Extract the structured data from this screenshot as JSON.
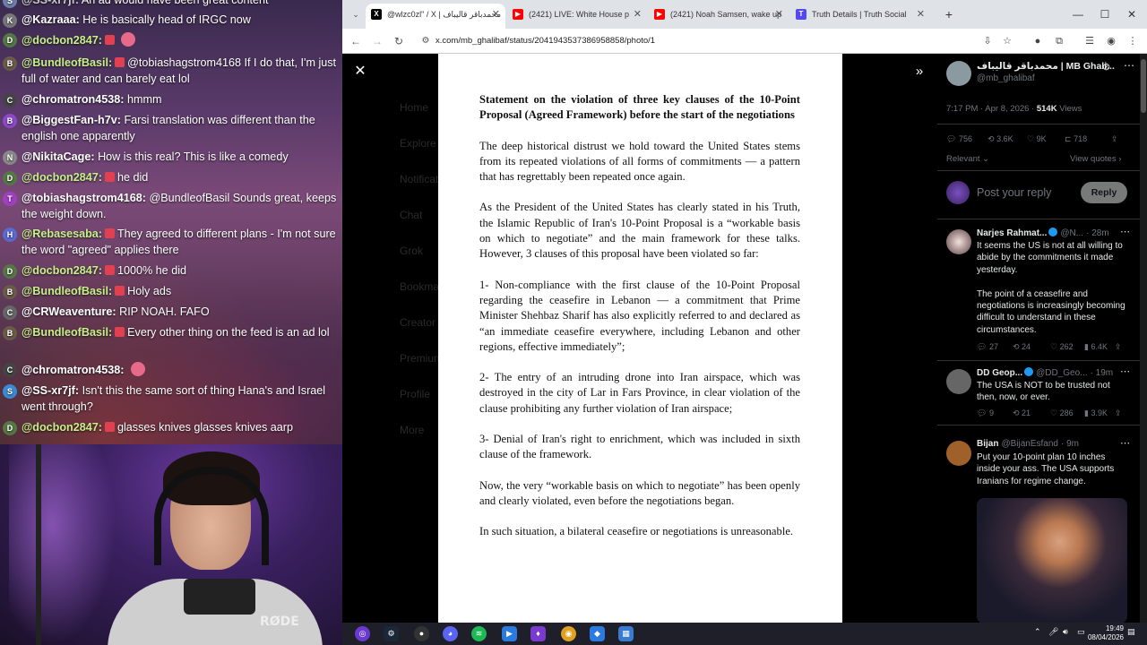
{
  "chat": {
    "messages": [
      {
        "user": "@SS-xr7jf:",
        "text": "An ad would have been great content",
        "color": "#c9c9c9",
        "avatar": "S",
        "avatar_color": "#6a7ea8"
      },
      {
        "user": "@Kazraaa:",
        "text": "He is basically head of IRGC now",
        "color": "#ffffff",
        "avatar": "K",
        "avatar_color": "#777777"
      },
      {
        "user": "@docbon2847:",
        "text": "",
        "color": "#c6f08a",
        "avatar": "D",
        "avatar_color": "#557744",
        "emote": true
      },
      {
        "user": "@BundleofBasil:",
        "text": "@tobiashagstrom4168 If I do that, I'm just full of water and can barely eat lol",
        "color": "#c6f08a",
        "avatar": "B",
        "avatar_color": "#6a5a48"
      },
      {
        "user": "@chromatron4538:",
        "text": "hmmm",
        "color": "#ffffff",
        "avatar": "C",
        "avatar_color": "#444444"
      },
      {
        "user": "@BiggestFan-h7v:",
        "text": "Farsi translation was different than the english one apparently",
        "color": "#ffffff",
        "avatar": "B",
        "avatar_color": "#8d48c8"
      },
      {
        "user": "@NikitaCage:",
        "text": "How is this real? This is like a comedy",
        "color": "#ffffff",
        "avatar": "N",
        "avatar_color": "#888888"
      },
      {
        "user": "@docbon2847:",
        "text": "he did",
        "color": "#c6f08a",
        "avatar": "D",
        "avatar_color": "#557744"
      },
      {
        "user": "@tobiashagstrom4168:",
        "text": "@BundleofBasil Sounds great, keeps the weight down.",
        "color": "#ffffff",
        "avatar": "T",
        "avatar_color": "#a040c0"
      },
      {
        "user": "@Rebasesaba:",
        "text": "They agreed to different plans - I'm not sure the word \"agreed\" applies there",
        "color": "#c6f08a",
        "avatar": "H",
        "avatar_color": "#5a6ad0"
      },
      {
        "user": "@docbon2847:",
        "text": "1000% he did",
        "color": "#c6f08a",
        "avatar": "D",
        "avatar_color": "#557744"
      },
      {
        "user": "@BundleofBasil:",
        "text": "Holy ads",
        "color": "#c6f08a",
        "avatar": "B",
        "avatar_color": "#6a5a48"
      },
      {
        "user": "@CRWeaventure:",
        "text": "RIP NOAH. FAFO",
        "color": "#ffffff",
        "avatar": "C",
        "avatar_color": "#666666"
      },
      {
        "user": "@BundleofBasil:",
        "text": "Every other thing on the feed is an ad lol",
        "color": "#c6f08a",
        "avatar": "B",
        "avatar_color": "#6a5a48"
      },
      {
        "user": "@chromatron4538:",
        "text": "",
        "color": "#ffffff",
        "avatar": "C",
        "avatar_color": "#444444",
        "emote": true
      },
      {
        "user": "@SS-xr7jf:",
        "text": "Isn't this the same sort of thing Hana's and Israel went through?",
        "color": "#ffffff",
        "avatar": "S",
        "avatar_color": "#3a8ad0"
      },
      {
        "user": "@docbon2847:",
        "text": "glasses knives glasses knives aarp",
        "color": "#c6f08a",
        "avatar": "D",
        "avatar_color": "#557744"
      }
    ]
  },
  "cam": {
    "brand": "RØDE"
  },
  "browser": {
    "tabs": [
      {
        "title": "@wlzc0zl\" / X | محمدباقر قالیباف",
        "icon": "X",
        "icon_color": "#000000"
      },
      {
        "title": "(2421) LIVE: White House p",
        "icon": "▶",
        "icon_color": "#ff0000"
      },
      {
        "title": "(2421) Noah Samsen, wake up",
        "icon": "▶",
        "icon_color": "#ff0000"
      },
      {
        "title": "Truth Details | Truth Social",
        "icon": "T",
        "icon_color": "#5448ee"
      }
    ],
    "url": "x.com/mb_ghalibaf/status/2041943537386958858/photo/1",
    "new_tab": "+",
    "minimize": "—",
    "maximize": "☐",
    "close": "✕"
  },
  "xnav": [
    "Home",
    "Explore",
    "Notifications",
    "Chat",
    "Grok",
    "Bookmarks",
    "Creator Studio",
    "Premium",
    "Profile",
    "More"
  ],
  "document": {
    "title": "Statement on the violation of three key clauses of the 10-Point Proposal (Agreed Framework) before the start of the negotiations",
    "paragraphs": [
      "The deep historical distrust we hold toward the United States stems from its repeated violations of all forms of commitments — a pattern that has regrettably been repeated once again.",
      "As the President of the United States has clearly stated in his Truth, the Islamic Republic of Iran's 10-Point Proposal is a “workable basis on which to negotiate” and the main framework for these talks. However, 3 clauses of this proposal have been violated so far:",
      "1- Non-compliance with the first clause of the 10-Point Proposal regarding the ceasefire in Lebanon — a commitment that Prime Minister Shehbaz Sharif has also explicitly referred to and declared as “an immediate ceasefire everywhere, including Lebanon and other regions, effective immediately”;",
      "2- The entry of an intruding drone into Iran airspace, which was destroyed in the city of Lar in Fars Province, in clear violation of the clause prohibiting any further violation of Iran airspace;",
      "3- Denial of Iran's right to enrichment, which was included  in sixth clause of the framework.",
      "Now, the very “workable basis on which to negotiate” has been openly and clearly violated, even before the negotiations began.",
      "In such situation, a bilateral ceasefire or negotiations is unreasonable."
    ]
  },
  "post": {
    "author_name": "محمدباقر قالیباف | MB Ghali...",
    "author_handle": "@mb_ghalibaf",
    "timestamp": "7:17 PM · Apr 8, 2026 · ",
    "views_count": "514K",
    "views_label": " Views",
    "replies": "756",
    "reposts": "3.6K",
    "likes": "9K",
    "bookmarks": "718",
    "sort_label": "Relevant",
    "view_quotes": "View quotes",
    "reply_placeholder": "Post your reply",
    "reply_button": "Reply"
  },
  "replies": [
    {
      "name": "Narjes Rahmat...",
      "handle": "@N...",
      "time": "· 28m",
      "verified": true,
      "text": "It seems the US is not at all willing to abide by the commitments it made yesterday.\n\nThe point of a ceasefire and negotiations is increasingly becoming difficult to understand in these circumstances.",
      "stats": {
        "replies": "27",
        "reposts": "24",
        "likes": "262",
        "views": "6.4K"
      }
    },
    {
      "name": "DD Geop...",
      "handle": "@DD_Geo...",
      "time": "· 19m",
      "verified": true,
      "text": "The USA is NOT to be trusted not then, now, or ever.",
      "stats": {
        "replies": "9",
        "reposts": "21",
        "likes": "286",
        "views": "3.9K"
      }
    },
    {
      "name": "Bijan",
      "handle": "@BijanEsfand",
      "time": "· 9m",
      "verified": false,
      "text": "Put your 10-point plan 10 inches inside your ass. The USA supports Iranians for regime change.",
      "stats": {}
    }
  ],
  "taskbar": {
    "time": "19:49",
    "date": "08/04/2026"
  }
}
